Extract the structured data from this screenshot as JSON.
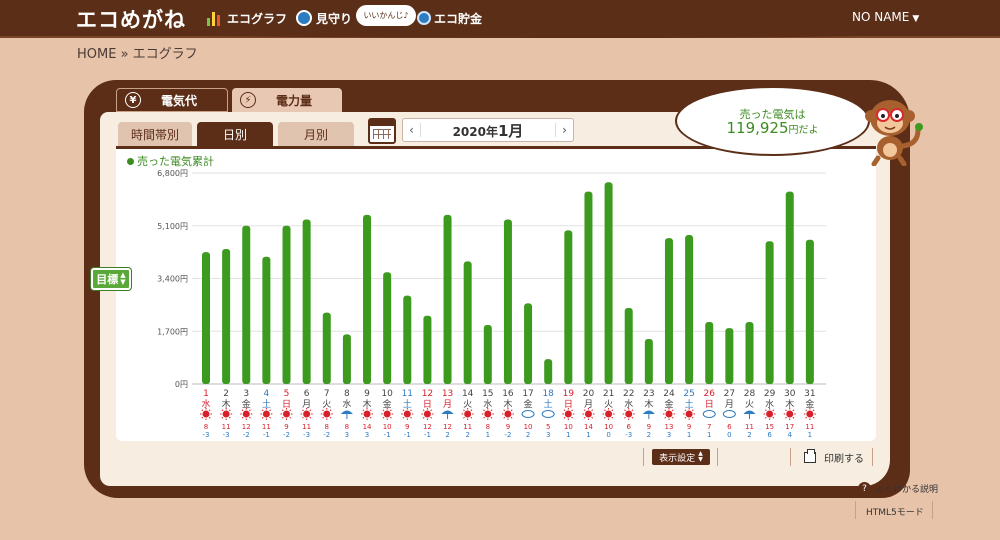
{
  "header": {
    "logo": "エコめがね",
    "nav": [
      {
        "label": "エコグラフ",
        "icon": "bar-chart-icon"
      },
      {
        "label": "見守り",
        "icon": "magnifier-icon"
      },
      {
        "label": "エコ貯金",
        "icon": "coin-icon"
      }
    ],
    "bubble": "いいかんじ♪",
    "user": "NO NAME"
  },
  "breadcrumb": "HOME » エコグラフ",
  "tabs": {
    "main": [
      {
        "label": "電気代",
        "icon_text": "¥",
        "active": true
      },
      {
        "label": "電力量",
        "icon_text": "⚡",
        "active": false
      }
    ],
    "sub": [
      {
        "label": "時間帯別",
        "active": false
      },
      {
        "label": "日別",
        "active": true
      },
      {
        "label": "月別",
        "active": false
      }
    ]
  },
  "month_nav": {
    "prev": "‹",
    "next": "›",
    "year": "2020年",
    "month": "1月"
  },
  "goal_button": "目標",
  "sold": {
    "label": "売った電気は",
    "value": "119,925",
    "unit": "円だよ"
  },
  "controls": {
    "display_settings": "表示設定",
    "print": "印刷する",
    "help": "よくわかる説明",
    "html5": "HTML5モード"
  },
  "colors": {
    "bar": "#3c9a1f",
    "saturday": "#2d7bc1",
    "holiday": "#d8202a",
    "brown": "#5c2e18"
  },
  "chart_data": {
    "type": "bar",
    "legend": "売った電気累計",
    "y_ticks": [
      "0円",
      "1,700円",
      "3,400円",
      "5,100円",
      "6,800円"
    ],
    "ylim": [
      0,
      6800
    ],
    "grid": true,
    "days": [
      "1",
      "2",
      "3",
      "4",
      "5",
      "6",
      "7",
      "8",
      "9",
      "10",
      "11",
      "12",
      "13",
      "14",
      "15",
      "16",
      "17",
      "18",
      "19",
      "20",
      "21",
      "22",
      "23",
      "24",
      "25",
      "26",
      "27",
      "28",
      "29",
      "30",
      "31"
    ],
    "weekdays": [
      "水",
      "木",
      "金",
      "土",
      "日",
      "月",
      "火",
      "水",
      "木",
      "金",
      "土",
      "日",
      "月",
      "火",
      "水",
      "木",
      "金",
      "土",
      "日",
      "月",
      "火",
      "水",
      "木",
      "金",
      "土",
      "日",
      "月",
      "火",
      "水",
      "木",
      "金"
    ],
    "day_types": [
      "h",
      "w",
      "w",
      "s",
      "h",
      "w",
      "w",
      "w",
      "w",
      "w",
      "s",
      "h",
      "h",
      "w",
      "w",
      "w",
      "w",
      "s",
      "h",
      "w",
      "w",
      "w",
      "w",
      "w",
      "s",
      "h",
      "w",
      "w",
      "w",
      "w",
      "w"
    ],
    "values": [
      4250,
      4350,
      5100,
      4100,
      5100,
      5300,
      2300,
      1600,
      5450,
      3600,
      2850,
      2200,
      5450,
      3950,
      1900,
      5300,
      2600,
      800,
      4950,
      6200,
      6500,
      2450,
      1450,
      4700,
      4800,
      2000,
      1800,
      2000,
      4600,
      6200,
      4650
    ],
    "weather": [
      "sun",
      "sun",
      "sun",
      "sun",
      "sun",
      "sun",
      "sun",
      "rain",
      "sun",
      "sun",
      "sun",
      "sun",
      "rain",
      "sun",
      "sun",
      "sun",
      "cloud",
      "cloud",
      "sun",
      "sun",
      "sun",
      "sun",
      "rain",
      "sun",
      "sun",
      "cloud",
      "cloud",
      "rain",
      "sun",
      "sun",
      "sun"
    ],
    "high_temps": [
      "8",
      "11",
      "12",
      "11",
      "9",
      "11",
      "8",
      "8",
      "14",
      "10",
      "9",
      "12",
      "12",
      "11",
      "8",
      "9",
      "10",
      "5",
      "10",
      "14",
      "10",
      "6",
      "9",
      "13",
      "9",
      "7",
      "6",
      "11",
      "15",
      "17",
      "11"
    ],
    "low_temps": [
      "-3",
      "-3",
      "-2",
      "-1",
      "-2",
      "-3",
      "-2",
      "3",
      "3",
      "-1",
      "-1",
      "-1",
      "2",
      "2",
      "1",
      "-2",
      "2",
      "3",
      "1",
      "1",
      "0",
      "-3",
      "2",
      "3",
      "1",
      "1",
      "0",
      "2",
      "6",
      "4",
      "1"
    ]
  }
}
